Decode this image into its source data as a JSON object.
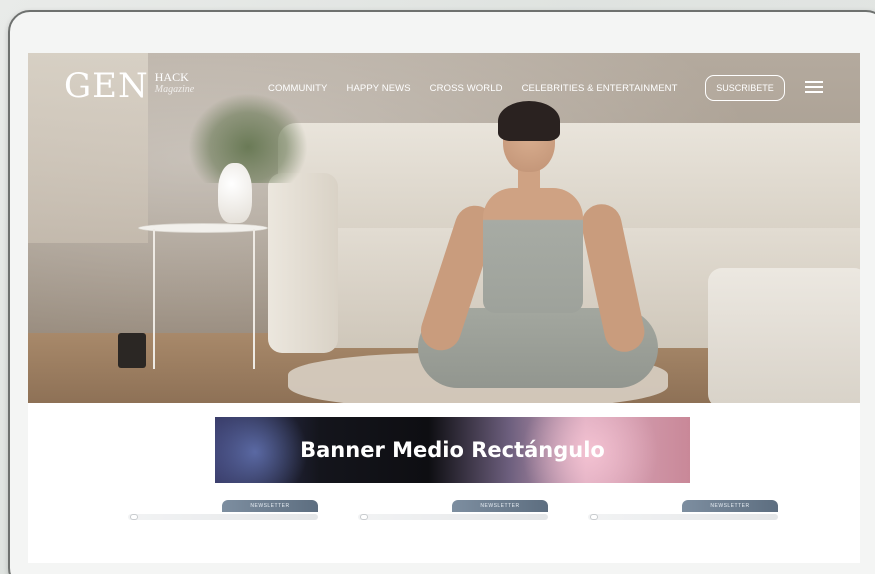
{
  "logo": {
    "main": "GEN",
    "hack": "HACK",
    "magazine": "Magazine"
  },
  "nav": {
    "items": [
      {
        "label": "COMMUNITY"
      },
      {
        "label": "HAPPY NEWS"
      },
      {
        "label": "CROSS WORLD"
      },
      {
        "label": "CELEBRITIES & ENTERTAINMENT"
      }
    ],
    "subscribe_label": "SUSCRIBETE",
    "menu_icon": "hamburger-menu-icon"
  },
  "banner": {
    "text": "Banner Medio Rectángulo"
  },
  "cards": [
    {
      "tab_label": "NEWSLETTER"
    },
    {
      "tab_label": "NEWSLETTER"
    },
    {
      "tab_label": "NEWSLETTER"
    }
  ],
  "colors": {
    "frame": "#6e716f",
    "card_tab": "#6d7e90",
    "text_on_hero": "#ffffff"
  }
}
